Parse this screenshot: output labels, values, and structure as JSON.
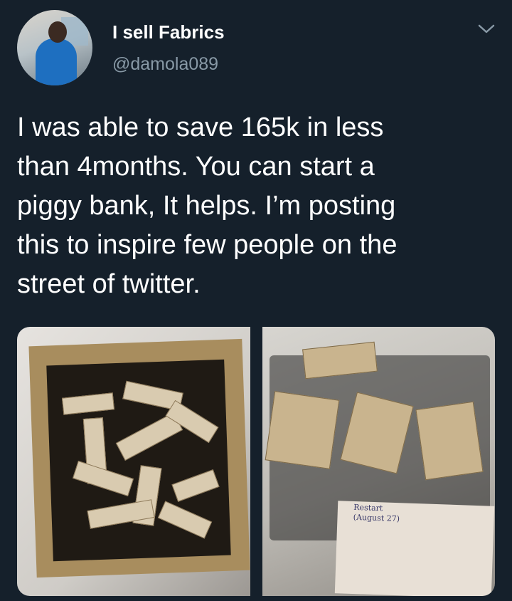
{
  "tweet": {
    "display_name": "I sell Fabrics",
    "handle": "@damola089",
    "text": "I was able to save 165k in less\nthan 4months. You can start a\npiggy bank, It helps. I’m posting\nthis to inspire few people on the\nstreet of twitter."
  },
  "icons": {
    "menu": "chevron-down-icon"
  },
  "media": {
    "right_photo_note": "Restart\n(August 27)"
  },
  "colors": {
    "background": "#15202b",
    "primary_text": "#ffffff",
    "secondary_text": "#8899a6"
  }
}
